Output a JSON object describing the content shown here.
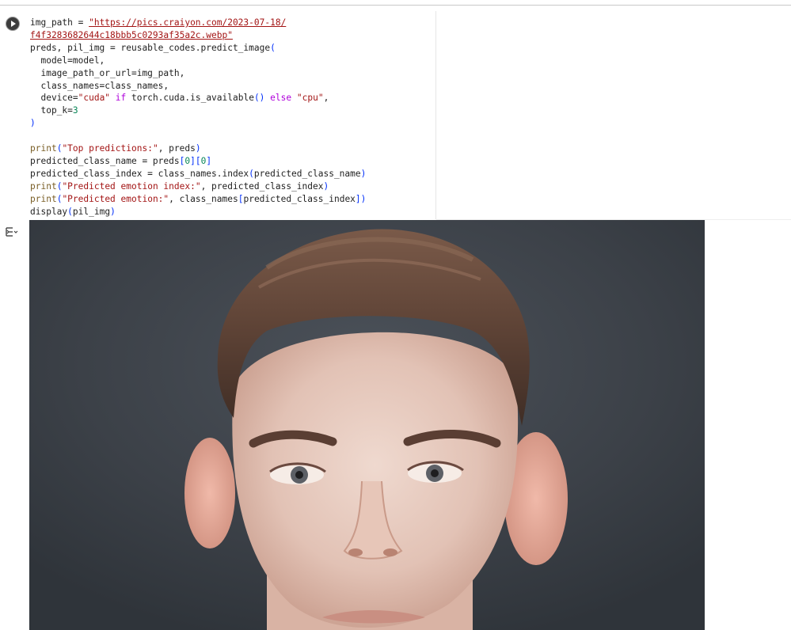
{
  "cell": {
    "run_button": "run-cell",
    "code_lines": [
      "img_path = \"https://pics.craiyon.com/2023-07-18/",
      "f4f3283682644c18bbb5c0293af35a2c.webp\"",
      "preds, pil_img = reusable_codes.predict_image(",
      "  model=model,",
      "  image_path_or_url=img_path,",
      "  class_names=class_names,",
      "  device=\"cuda\" if torch.cuda.is_available() else \"cpu\",",
      "  top_k=3",
      ")",
      "",
      "print(\"Top predictions:\", preds)",
      "predicted_class_name = preds[0][0]",
      "predicted_class_index = class_names.index(predicted_class_name)",
      "print(\"Predicted emotion index:\", predicted_class_index)",
      "print(\"Predicted emotion:\", class_names[predicted_class_index])",
      "display(pil_img)"
    ]
  },
  "output": {
    "gutter_icon": "output-toggle-icon",
    "image_description": "portrait-photo"
  },
  "colors": {
    "string": "#a31515",
    "keyword": "#af00db",
    "function": "#795e26",
    "number": "#098658",
    "bracket": "#0431fa",
    "background_photo": "#3b4047"
  }
}
